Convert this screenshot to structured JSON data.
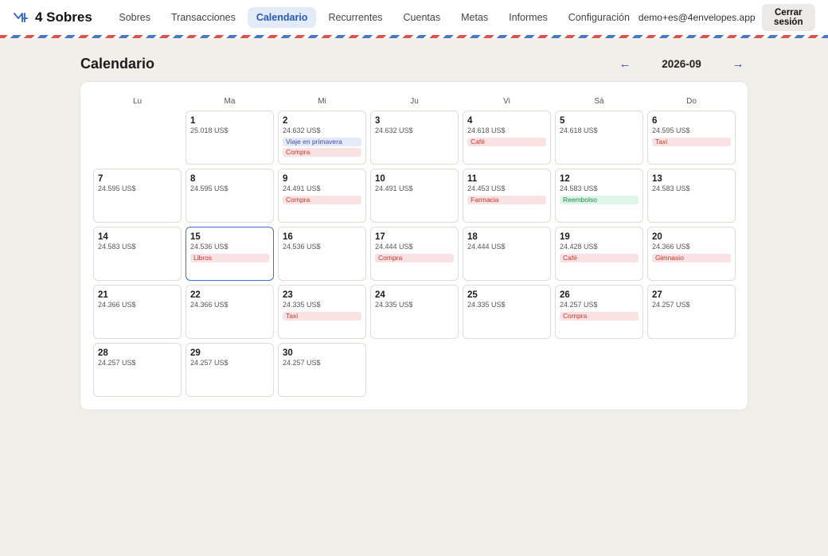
{
  "app": {
    "name": "4 Sobres"
  },
  "nav": {
    "items": [
      {
        "label": "Sobres"
      },
      {
        "label": "Transacciones"
      },
      {
        "label": "Calendario",
        "active": true
      },
      {
        "label": "Recurrentes"
      },
      {
        "label": "Cuentas"
      },
      {
        "label": "Metas"
      },
      {
        "label": "Informes"
      },
      {
        "label": "Configuración"
      }
    ]
  },
  "user": {
    "email": "demo+es@4envelopes.app",
    "logout_label": "Cerrar sesión"
  },
  "page": {
    "title": "Calendario",
    "month": "2026-09",
    "prev_arrow": "←",
    "next_arrow": "→"
  },
  "calendar": {
    "weekdays": [
      "Lu",
      "Ma",
      "Mi",
      "Ju",
      "Vi",
      "Sá",
      "Do"
    ],
    "start_offset": 1,
    "today": 15,
    "days": [
      {
        "day": "1",
        "balance": "25.018 US$",
        "events": []
      },
      {
        "day": "2",
        "balance": "24.632 US$",
        "events": [
          {
            "label": "Viaje en primavera",
            "kind": "goal"
          },
          {
            "label": "Compra",
            "kind": "expense"
          }
        ]
      },
      {
        "day": "3",
        "balance": "24.632 US$",
        "events": []
      },
      {
        "day": "4",
        "balance": "24.618 US$",
        "events": [
          {
            "label": "Café",
            "kind": "expense"
          }
        ]
      },
      {
        "day": "5",
        "balance": "24.618 US$",
        "events": []
      },
      {
        "day": "6",
        "balance": "24.595 US$",
        "events": [
          {
            "label": "Taxi",
            "kind": "expense"
          }
        ]
      },
      {
        "day": "7",
        "balance": "24.595 US$",
        "events": []
      },
      {
        "day": "8",
        "balance": "24.595 US$",
        "events": []
      },
      {
        "day": "9",
        "balance": "24.491 US$",
        "events": [
          {
            "label": "Compra",
            "kind": "expense"
          }
        ]
      },
      {
        "day": "10",
        "balance": "24.491 US$",
        "events": []
      },
      {
        "day": "11",
        "balance": "24.453 US$",
        "events": [
          {
            "label": "Farmacia",
            "kind": "expense"
          }
        ]
      },
      {
        "day": "12",
        "balance": "24.583 US$",
        "events": [
          {
            "label": "Reembolso",
            "kind": "income"
          }
        ]
      },
      {
        "day": "13",
        "balance": "24.583 US$",
        "events": []
      },
      {
        "day": "14",
        "balance": "24.583 US$",
        "events": []
      },
      {
        "day": "15",
        "balance": "24.536 US$",
        "events": [
          {
            "label": "Libros",
            "kind": "expense"
          }
        ]
      },
      {
        "day": "16",
        "balance": "24.536 US$",
        "events": []
      },
      {
        "day": "17",
        "balance": "24.444 US$",
        "events": [
          {
            "label": "Compra",
            "kind": "expense"
          }
        ]
      },
      {
        "day": "18",
        "balance": "24.444 US$",
        "events": []
      },
      {
        "day": "19",
        "balance": "24.428 US$",
        "events": [
          {
            "label": "Café",
            "kind": "expense"
          }
        ]
      },
      {
        "day": "20",
        "balance": "24.366 US$",
        "events": [
          {
            "label": "Gimnasio",
            "kind": "expense"
          }
        ]
      },
      {
        "day": "21",
        "balance": "24.366 US$",
        "events": []
      },
      {
        "day": "22",
        "balance": "24.366 US$",
        "events": []
      },
      {
        "day": "23",
        "balance": "24.335 US$",
        "events": [
          {
            "label": "Taxi",
            "kind": "expense"
          }
        ]
      },
      {
        "day": "24",
        "balance": "24.335 US$",
        "events": []
      },
      {
        "day": "25",
        "balance": "24.335 US$",
        "events": []
      },
      {
        "day": "26",
        "balance": "24.257 US$",
        "events": [
          {
            "label": "Compra",
            "kind": "expense"
          }
        ]
      },
      {
        "day": "27",
        "balance": "24.257 US$",
        "events": []
      },
      {
        "day": "28",
        "balance": "24.257 US$",
        "events": []
      },
      {
        "day": "29",
        "balance": "24.257 US$",
        "events": []
      },
      {
        "day": "30",
        "balance": "24.257 US$",
        "events": []
      }
    ]
  }
}
